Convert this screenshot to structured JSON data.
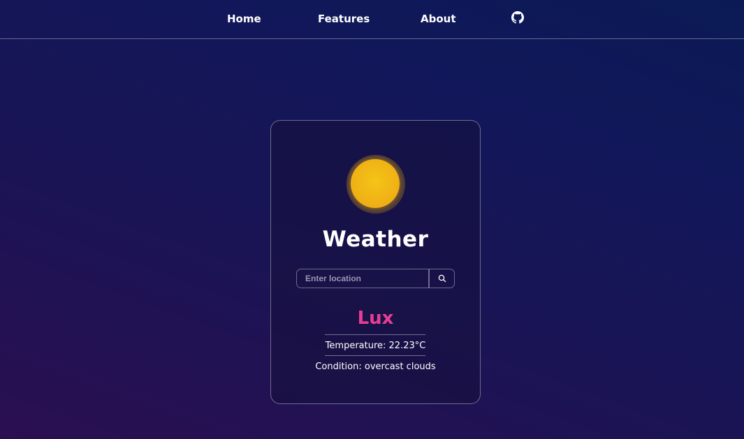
{
  "nav": {
    "home": "Home",
    "features": "Features",
    "about": "About",
    "github_icon": "github-icon"
  },
  "card": {
    "icon": "sun-icon",
    "title": "Weather",
    "search": {
      "placeholder": "Enter location",
      "value": "",
      "button_icon": "search-icon"
    },
    "city": "Lux",
    "temperature": "Temperature: 22.23°C",
    "condition": "Condition: overcast clouds"
  },
  "colors": {
    "city_accent": "#e83d95",
    "sun": "#f0b015"
  }
}
